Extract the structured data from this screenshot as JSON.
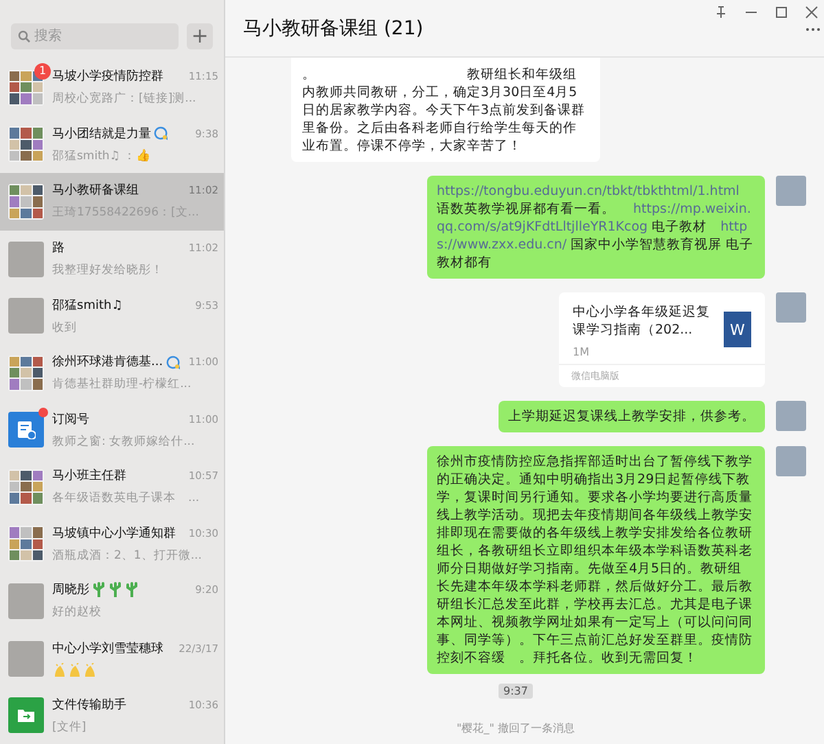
{
  "sidebar": {
    "search": {
      "placeholder": "搜索"
    },
    "add_button": "+",
    "chats": [
      {
        "name": "马坡小学疫情防控群",
        "time": "11:15",
        "preview": "周校心宽路广：[链接]测...",
        "kind": "group",
        "badge": "1",
        "unread_dot": false,
        "status_icon": false,
        "selected": false
      },
      {
        "name": "马小团结就是力量",
        "time": "9:38",
        "preview": "邵猛smith♫ ：👍",
        "kind": "group",
        "unread_dot": false,
        "status_icon": true,
        "selected": false
      },
      {
        "name": "马小教研备课组",
        "time": "11:02",
        "preview": "王琦17558422696：[文...",
        "kind": "group",
        "unread_dot": false,
        "status_icon": false,
        "selected": true
      },
      {
        "name": "路",
        "time": "11:02",
        "preview": "我整理好发给晓彤！",
        "kind": "photo",
        "unread_dot": false,
        "status_icon": false,
        "selected": false
      },
      {
        "name": "邵猛smith♫",
        "time": "9:53",
        "preview": "收到",
        "kind": "photo",
        "unread_dot": false,
        "status_icon": false,
        "selected": false
      },
      {
        "name": "徐州环球港肯德基...",
        "time": "11:00",
        "preview": "肯德基社群助理-柠檬红...",
        "kind": "group",
        "unread_dot": false,
        "status_icon": true,
        "selected": false
      },
      {
        "name": "订阅号",
        "time": "11:00",
        "preview": "教师之窗: 女教师嫁给什...",
        "kind": "subscription",
        "unread_dot": true,
        "status_icon": false,
        "selected": false
      },
      {
        "name": "马小班主任群",
        "time": "10:57",
        "preview": "各年级语数英电子课本　...",
        "kind": "group",
        "unread_dot": false,
        "status_icon": false,
        "selected": false
      },
      {
        "name": "马坡镇中心小学通知群",
        "time": "10:30",
        "preview": "酒瓶成酒：2、1、打开微...",
        "kind": "group",
        "unread_dot": false,
        "status_icon": false,
        "selected": false
      },
      {
        "name": "周晓彤",
        "time": "9:20",
        "preview": "好的赵校",
        "kind": "photo",
        "emoji": [
          {
            "kind": "cactus"
          },
          {
            "kind": "cactus"
          },
          {
            "kind": "cactus"
          }
        ],
        "unread_dot": false,
        "status_icon": false,
        "selected": false
      },
      {
        "name": "中心小学刘雪莹穗球",
        "time": "22/3/17",
        "kind": "photo",
        "preview_emoji": [
          {
            "kind": "clap"
          },
          {
            "kind": "clap"
          },
          {
            "kind": "clap"
          }
        ],
        "unread_dot": false,
        "status_icon": false,
        "selected": false
      },
      {
        "name": "文件传输助手",
        "time": "10:36",
        "preview": "[文件]",
        "kind": "file-transfer",
        "unread_dot": false,
        "status_icon": false,
        "selected": false
      }
    ]
  },
  "chat": {
    "title": "马小教研备课组 (21)",
    "messages": [
      {
        "kind": "incoming",
        "text": "。　　　　　　　　　　　教研组长和年级组内教师共同教研，分工，确定3月30日至4月5日的居家教学内容。今天下午3点前发到备课群里备份。之后由各科老师自行给学生每天的作业布置。停课不停学，大家辛苦了！"
      },
      {
        "kind": "outgoing",
        "parts": [
          {
            "kind": "link",
            "text": "https://tongbu.eduyun.cn/tbkt/tbkthtml/1.html"
          },
          {
            "kind": "text",
            "text": " 语数英教学视屏都有看一看。　 "
          },
          {
            "kind": "link",
            "text": "https://mp.weixin.qq.com/s/at9jKFdtLltjlleYR1Kcog"
          },
          {
            "kind": "text",
            "text": " 电子教材　"
          },
          {
            "kind": "link",
            "text": "https://www.zxx.edu.cn/"
          },
          {
            "kind": "text",
            "text": " 国家中小学智慧教育视屏 电子教材都有"
          }
        ]
      },
      {
        "kind": "file",
        "title": "中心小学各年级延迟复课学习指南（202...",
        "size": "1M",
        "source": "微信电脑版",
        "file_letter": "W"
      },
      {
        "kind": "outgoing",
        "text": "上学期延迟复课线上教学安排，供参考。"
      },
      {
        "kind": "outgoing",
        "text": "徐州市疫情防控应急指挥部适时出台了暂停线下教学的正确决定。通知中明确指出3月29日起暂停线下教学，复课时间另行通知。要求各小学均要进行高质量线上教学活动。现把去年疫情期间各年级线上教学安排即现在需要做的各年级线上教学安排发给各位教研组长，各教研组长立即组织本年级本学科语数英科老师分日期做好学习指南。先做至4月5日的。教研组长先建本年级本学科老师群，然后做好分工。最后教研组长汇总发至此群，学校再去汇总。尤其是电子课本网址、视频教学网址如果有一定写上（可以问问同事、同学等）。下午三点前汇总好发至群里。疫情防控刻不容缓　。拜托各位。收到无需回复！"
      },
      {
        "kind": "time",
        "text": "9:37"
      },
      {
        "kind": "system",
        "text": "\"樱花_\" 撤回了一条消息"
      }
    ]
  }
}
